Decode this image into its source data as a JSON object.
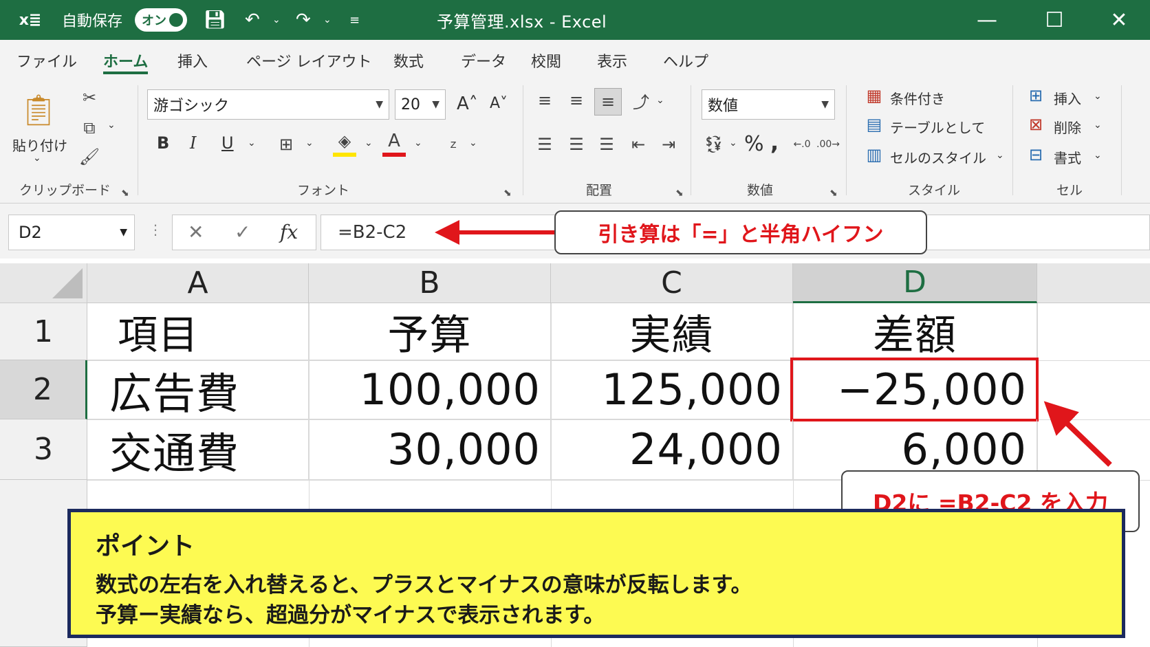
{
  "titlebar": {
    "logo": "x≣",
    "autosave_label": "自動保存",
    "autosave_state": "オン",
    "window_title": "予算管理.xlsx  -  Excel",
    "bg_color": "#1e6e42"
  },
  "tabs": [
    {
      "label": "ファイル"
    },
    {
      "label": "ホーム"
    },
    {
      "label": "挿入"
    },
    {
      "label": "ページ レイアウト"
    },
    {
      "label": "数式"
    },
    {
      "label": "データ"
    },
    {
      "label": "校閲"
    },
    {
      "label": "表示"
    },
    {
      "label": "ヘルプ"
    }
  ],
  "ribbon": {
    "clipboard": {
      "paste_label": "貼り付け",
      "group_label": "クリップボード"
    },
    "font": {
      "font_name": "游ゴシック",
      "font_size": "20",
      "group_label": "フォント",
      "bold": "B",
      "italic": "I",
      "underline": "U"
    },
    "alignment": {
      "group_label": "配置"
    },
    "number": {
      "format": "数値",
      "group_label": "数値",
      "percent": "%",
      "comma": ","
    },
    "styles": {
      "conditional": "条件付き",
      "table": "テーブルとして",
      "cell_style": "セルのスタイル",
      "group_label": "スタイル"
    },
    "cells": {
      "insert": "挿入",
      "delete": "削除",
      "format": "書式",
      "group_label": "セル"
    }
  },
  "formula_bar": {
    "name_box": "D2",
    "fx": "fx",
    "formula": "=B2-C2"
  },
  "callouts": {
    "formula_note": "引き算は「=」と半角ハイフン",
    "cell_note": "D2に =B2-C2 を入力"
  },
  "grid": {
    "columns": [
      "A",
      "B",
      "C",
      "D"
    ],
    "rows": [
      {
        "num": "1",
        "cells": [
          "項目",
          "予算",
          "実績",
          "差額"
        ]
      },
      {
        "num": "2",
        "cells": [
          "広告費",
          "100,000",
          "125,000",
          "−25,000"
        ]
      },
      {
        "num": "3",
        "cells": [
          "交通費",
          "30,000",
          "24,000",
          "6,000"
        ]
      }
    ],
    "selected_cell": "D2",
    "accent_color": "#1e6e42",
    "highlight_color": "#e0161b"
  },
  "point": {
    "title": "ポイント",
    "line1": "数式の左右を入れ替えると、プラスとマイナスの意味が反転します。",
    "line2": "予算ー実績なら、超過分がマイナスで表示されます。"
  }
}
